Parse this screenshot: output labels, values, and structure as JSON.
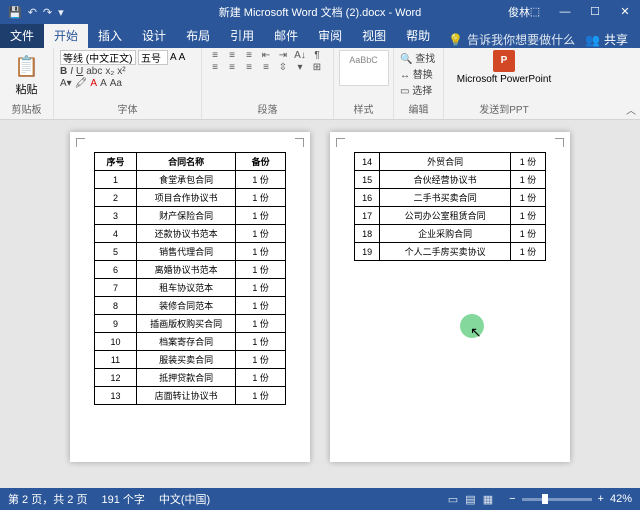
{
  "titlebar": {
    "title": "新建 Microsoft Word 文档 (2).docx - Word",
    "user": "俊林"
  },
  "tabs": {
    "file": "文件",
    "home": "开始",
    "insert": "插入",
    "design": "设计",
    "layout": "布局",
    "references": "引用",
    "mailings": "邮件",
    "review": "审阅",
    "view": "视图",
    "help": "帮助",
    "tellme": "告诉我你想要做什么",
    "share": "共享"
  },
  "ribbon": {
    "clipboard": {
      "paste": "粘贴",
      "label": "剪贴板"
    },
    "font": {
      "name": "等线 (中文正文)",
      "size": "五号",
      "label": "字体"
    },
    "paragraph": {
      "label": "段落"
    },
    "styles": {
      "label": "样式",
      "normal": "AaBbC"
    },
    "editing": {
      "find": "查找",
      "replace": "替换",
      "select": "选择",
      "label": "编辑"
    },
    "ppt": {
      "brand": "Microsoft PowerPoint",
      "label": "发送到PPT"
    }
  },
  "table1": {
    "headers": {
      "c1": "序号",
      "c2": "合同名称",
      "c3": "备份"
    },
    "rows": [
      {
        "n": "1",
        "name": "食堂承包合同",
        "q": "1 份"
      },
      {
        "n": "2",
        "name": "项目合作协议书",
        "q": "1 份"
      },
      {
        "n": "3",
        "name": "财产保险合同",
        "q": "1 份"
      },
      {
        "n": "4",
        "name": "还款协议书范本",
        "q": "1 份"
      },
      {
        "n": "5",
        "name": "销售代理合同",
        "q": "1 份"
      },
      {
        "n": "6",
        "name": "离婚协议书范本",
        "q": "1 份"
      },
      {
        "n": "7",
        "name": "租车协议范本",
        "q": "1 份"
      },
      {
        "n": "8",
        "name": "装修合同范本",
        "q": "1 份"
      },
      {
        "n": "9",
        "name": "插画版权购买合同",
        "q": "1 份"
      },
      {
        "n": "10",
        "name": "档案寄存合同",
        "q": "1 份"
      },
      {
        "n": "11",
        "name": "服装买卖合同",
        "q": "1 份"
      },
      {
        "n": "12",
        "name": "抵押贷款合同",
        "q": "1 份"
      },
      {
        "n": "13",
        "name": "店面转让协议书",
        "q": "1 份"
      }
    ]
  },
  "table2": {
    "rows": [
      {
        "n": "14",
        "name": "外贸合同",
        "q": "1 份"
      },
      {
        "n": "15",
        "name": "合伙经营协议书",
        "q": "1 份"
      },
      {
        "n": "16",
        "name": "二手书买卖合同",
        "q": "1 份"
      },
      {
        "n": "17",
        "name": "公司办公室租赁合同",
        "q": "1 份"
      },
      {
        "n": "18",
        "name": "企业采购合同",
        "q": "1 份"
      },
      {
        "n": "19",
        "name": "个人二手房买卖协议",
        "q": "1 份"
      }
    ]
  },
  "status": {
    "page": "第 2 页，共 2 页",
    "words": "191 个字",
    "lang": "中文(中国)",
    "zoom": "42%"
  }
}
